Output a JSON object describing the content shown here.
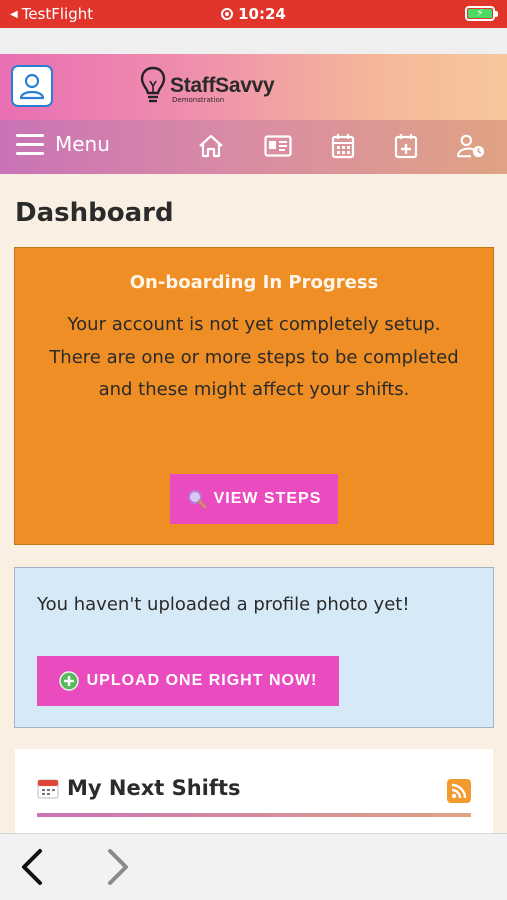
{
  "status_bar": {
    "back_app": "TestFlight",
    "time": "10:24"
  },
  "header": {
    "brand_name": "StaffSavvy",
    "brand_sub": "Demonstration"
  },
  "nav": {
    "menu_label": "Menu",
    "icons": [
      "home-icon",
      "id-card-icon",
      "calendar-icon",
      "calendar-plus-icon",
      "user-clock-icon"
    ]
  },
  "page": {
    "title": "Dashboard"
  },
  "onboarding": {
    "title": "On-boarding In Progress",
    "message": "Your account is not yet completely setup. There are one or more steps to be completed and these might affect your shifts.",
    "button_label": "VIEW STEPS"
  },
  "profile_photo": {
    "message": "You haven't uploaded a profile photo yet!",
    "button_label": "UPLOAD ONE RIGHT NOW!"
  },
  "shifts": {
    "title": "My Next Shifts"
  },
  "colors": {
    "status_bar": "#e1342b",
    "accent_pink": "#ea4cc0",
    "onboarding_bg": "#ef8e25",
    "photo_box_bg": "#d5e9f7",
    "page_bg": "#f9efe3"
  }
}
